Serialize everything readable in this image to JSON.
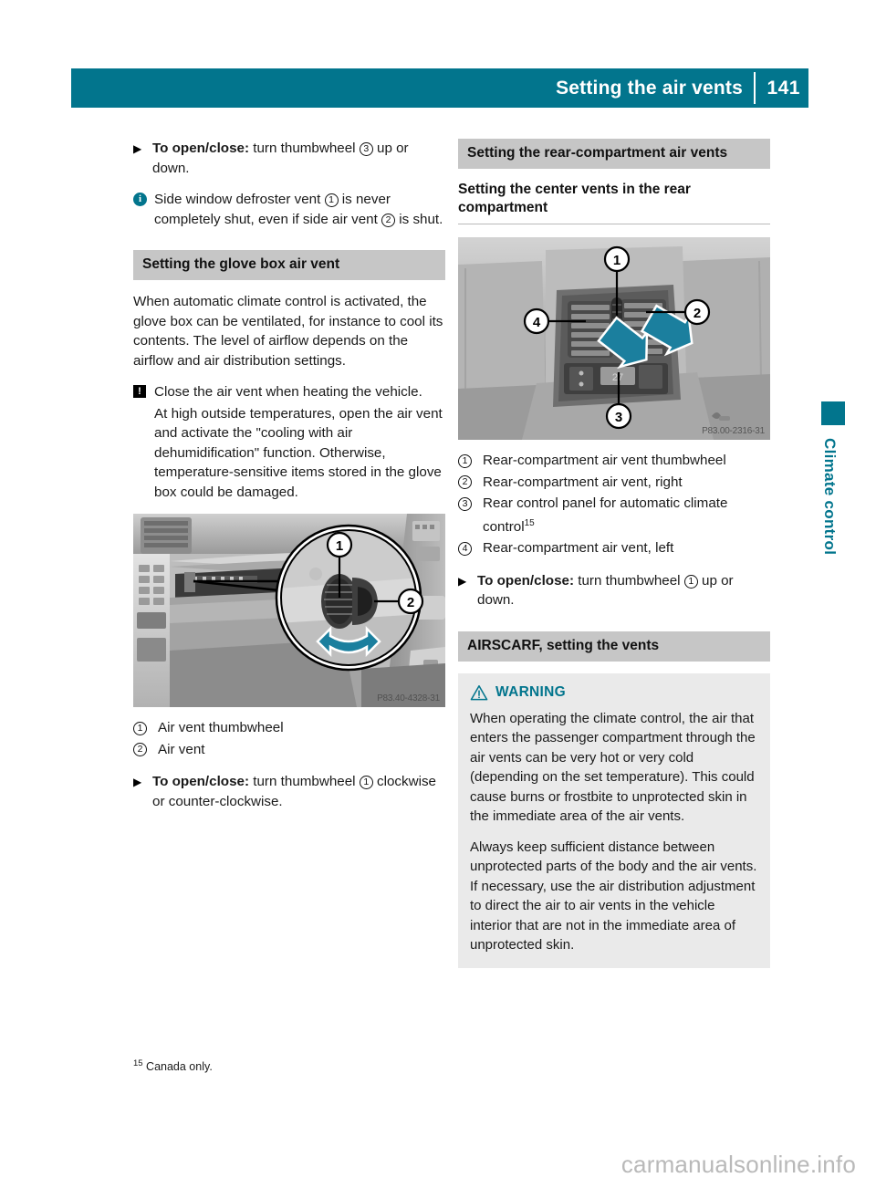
{
  "header": {
    "title": "Setting the air vents",
    "page_number": "141",
    "accent_color": "#02758D"
  },
  "side_tab": {
    "label": "Climate control",
    "color": "#02758D"
  },
  "left_column": {
    "step_open_close_top": {
      "marker": "▶",
      "bold": "To open/close:",
      "text_before_num": " turn thumbwheel ",
      "circled_number": "3",
      "text_after_num": " up or down."
    },
    "note_side_window": {
      "icon": "info-icon",
      "icon_glyph": "i",
      "part1": "Side window defroster vent ",
      "num1": "1",
      "part2": " is never completely shut, even if side air vent ",
      "num2": "2",
      "part3": " is shut."
    },
    "heading_glove_box": "Setting the glove box air vent",
    "para_glove_box": "When automatic climate control is activated, the glove box can be ventilated, for instance to cool its contents. The level of airflow depends on the airflow and air distribution settings.",
    "caution_glove_box": {
      "icon": "caution-icon",
      "icon_glyph": "!",
      "line1": "Close the air vent when heating the vehicle.",
      "line2": "At high outside temperatures, open the air vent and activate the \"cooling with air dehumidification\" function. Otherwise, temperature-sensitive items stored in the glove box could be damaged."
    },
    "figure": {
      "id_caption": "P83.40-4328-31",
      "alt": "Glove box air vent with magnified detail showing thumbwheel and vent",
      "callouts": [
        "1",
        "2"
      ]
    },
    "legend": [
      {
        "num": "1",
        "text": "Air vent thumbwheel"
      },
      {
        "num": "2",
        "text": "Air vent"
      }
    ],
    "step_open_close_bottom": {
      "marker": "▶",
      "bold": "To open/close:",
      "text_before_num": " turn thumbwheel ",
      "circled_number": "1",
      "text_after_num": " clockwise or counter-clockwise."
    }
  },
  "right_column": {
    "heading_rear_compartment": "Setting the rear-compartment air vents",
    "subheading_center_vents": "Setting the center vents in the rear compartment",
    "figure": {
      "id_caption": "P83.00-2316-31",
      "alt": "Rear-compartment center console air vents",
      "callouts": [
        "1",
        "2",
        "3",
        "4"
      ]
    },
    "legend": [
      {
        "num": "1",
        "text": "Rear-compartment air vent thumbwheel",
        "footnote": ""
      },
      {
        "num": "2",
        "text": "Rear-compartment air vent, right",
        "footnote": ""
      },
      {
        "num": "3",
        "text": "Rear control panel for automatic climate control",
        "footnote": "15"
      },
      {
        "num": "4",
        "text": "Rear-compartment air vent, left",
        "footnote": ""
      }
    ],
    "step_open_close": {
      "marker": "▶",
      "bold": "To open/close:",
      "text_before_num": " turn thumbwheel ",
      "circled_number": "1",
      "text_after_num": " up or down."
    },
    "heading_airscarf": "AIRSCARF, setting the vents",
    "warning": {
      "icon": "warning-triangle-icon",
      "label": "WARNING",
      "label_color": "#02758D",
      "paragraphs": [
        "When operating the climate control, the air that enters the passenger compartment through the air vents can be very hot or very cold (depending on the set temperature). This could cause burns or frostbite to unprotected skin in the immediate area of the air vents.",
        "Always keep sufficient distance between unprotected parts of the body and the air vents. If necessary, use the air distribution adjustment to direct the air to air vents in the vehicle interior that are not in the immediate area of unprotected skin."
      ]
    }
  },
  "footnote": {
    "marker": "15",
    "text": " Canada only."
  },
  "watermark": "carmanualsonline.info"
}
